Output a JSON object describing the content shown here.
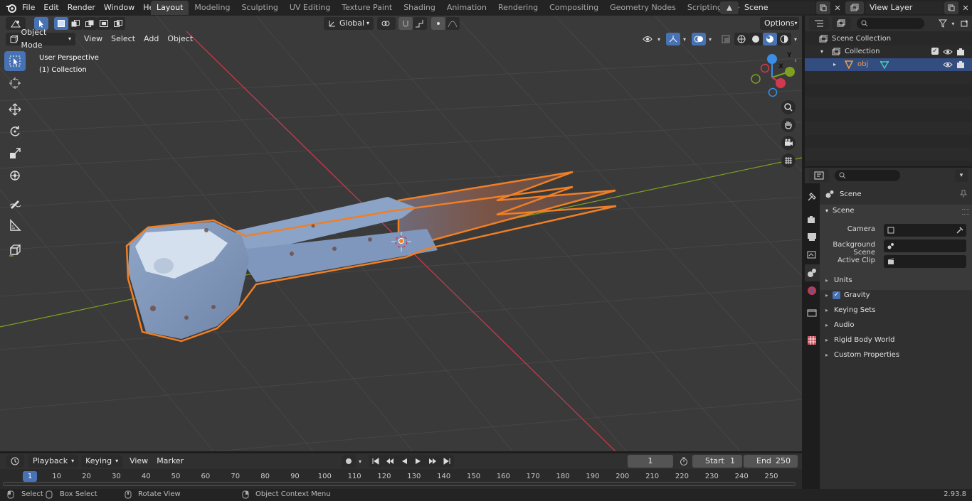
{
  "topbar": {
    "menus": [
      "File",
      "Edit",
      "Render",
      "Window",
      "Help"
    ],
    "workspaces": [
      "Layout",
      "Modeling",
      "Sculpting",
      "UV Editing",
      "Texture Paint",
      "Shading",
      "Animation",
      "Rendering",
      "Compositing",
      "Geometry Nodes",
      "Scripting"
    ],
    "active_workspace": "Layout",
    "scene_name": "Scene",
    "view_layer": "View Layer"
  },
  "viewport": {
    "mode": "Object Mode",
    "menus": [
      "View",
      "Select",
      "Add",
      "Object"
    ],
    "transform_orientation": "Global",
    "options_label": "Options",
    "perspective_label": "User Perspective",
    "collection_label": "(1) Collection",
    "gizmo_axes": {
      "x": "X",
      "y": "Y",
      "z": "Z"
    },
    "colors": {
      "x_axis": "#d03a4e",
      "y_axis": "#7ea021",
      "z_axis": "#3a8ee6",
      "selection_outline": "#f07f25"
    }
  },
  "outliner": {
    "rows": [
      {
        "label": "Scene Collection",
        "depth": 0
      },
      {
        "label": "Collection",
        "depth": 1
      },
      {
        "label": "obj",
        "depth": 2
      }
    ]
  },
  "properties": {
    "context_title": "Scene",
    "section_title": "Scene",
    "fields": [
      {
        "label": "Camera"
      },
      {
        "label": "Background Scene"
      },
      {
        "label": "Active Clip"
      }
    ],
    "panels": [
      "Units",
      "Gravity",
      "Keying Sets",
      "Audio",
      "Rigid Body World",
      "Custom Properties"
    ],
    "gravity_checked": true
  },
  "timeline": {
    "menus": [
      "Playback",
      "Keying",
      "View",
      "Marker"
    ],
    "current_frame": "1",
    "start_label": "Start",
    "start_value": "1",
    "end_label": "End",
    "end_value": "250",
    "ticks": [
      "1",
      "10",
      "20",
      "30",
      "40",
      "50",
      "60",
      "70",
      "80",
      "90",
      "100",
      "110",
      "120",
      "130",
      "140",
      "150",
      "160",
      "170",
      "180",
      "190",
      "200",
      "210",
      "220",
      "230",
      "240",
      "250"
    ]
  },
  "statusbar": {
    "items": [
      "Select",
      "Box Select",
      "Rotate View",
      "Object Context Menu"
    ],
    "version": "2.93.8"
  }
}
